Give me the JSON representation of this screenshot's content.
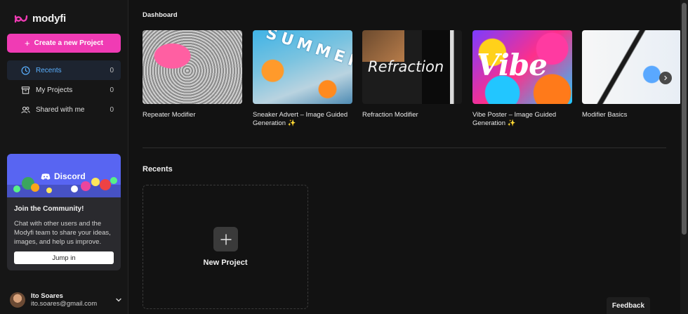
{
  "app": {
    "name": "modyfi",
    "accent": "#f03bb4"
  },
  "sidebar": {
    "create_label": "Create a new Project",
    "items": [
      {
        "label": "Recents",
        "count": "0",
        "icon": "clock-icon",
        "active": true
      },
      {
        "label": "My Projects",
        "count": "0",
        "icon": "archive-box-icon",
        "active": false
      },
      {
        "label": "Shared with me",
        "count": "0",
        "icon": "users-icon",
        "active": false
      }
    ],
    "community": {
      "brand": "Discord",
      "title": "Join the Community!",
      "body": "Chat with other users and the Modyfi team to share your ideas, images, and help us improve.",
      "button": "Jump in"
    },
    "user": {
      "name": "Ito Soares",
      "email": "ito.soares@gmail.com"
    }
  },
  "main": {
    "dashboard_title": "Dashboard",
    "templates": [
      {
        "label": "Repeater Modifier"
      },
      {
        "label": "Sneaker Advert – Image Guided Generation ✨",
        "thumb_text": "SUMMER"
      },
      {
        "label": "Refraction Modifier",
        "thumb_text": "Refraction"
      },
      {
        "label": "Vibe Poster – Image Guided Generation ✨",
        "thumb_text": "Vibe"
      },
      {
        "label": "Modifier Basics"
      }
    ],
    "recents_title": "Recents",
    "new_project_label": "New Project"
  },
  "feedback_label": "Feedback"
}
